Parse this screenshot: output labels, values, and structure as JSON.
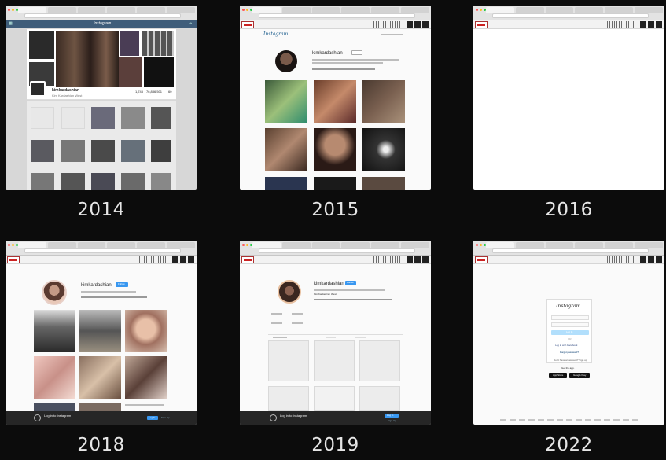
{
  "years": [
    "2014",
    "2015",
    "2016",
    "2018",
    "2019",
    "2022"
  ],
  "panel_2014": {
    "header_title": "Instagram",
    "username": "kimkardashian",
    "bio": "Kim Kardashian West",
    "stats": [
      "1,745",
      "76,886,501",
      "60"
    ]
  },
  "panel_2015": {
    "logo": "Instagram",
    "username": "kimkardashian",
    "follow_label": "Follow"
  },
  "panel_2018": {
    "username": "kimkardashian",
    "follow_label": "Follow",
    "banner_title": "Log in to Instagram",
    "banner_login": "Log In",
    "banner_signup": "Sign Up"
  },
  "panel_2019": {
    "username": "kimkardashian",
    "bio": "Kim Kardashian West",
    "follow_label": "Follow",
    "banner_title": "Log in to Instagram",
    "banner_login": "Log In",
    "banner_signup": "Sign Up"
  },
  "panel_2022": {
    "logo": "Instagram",
    "login_button": "Log In",
    "or": "OR",
    "facebook_login": "Log in with Facebook",
    "forgot": "Forgot password?",
    "signup_prompt": "Don't have an account? Sign up",
    "get_app": "Get the app.",
    "app_store": "App Store",
    "google_play": "Google Play"
  },
  "colors": {
    "background": "#0c0c0c",
    "year_text": "#e6e6e6",
    "instagram_blue": "#3897f0",
    "page_bg": "#fafafa"
  }
}
